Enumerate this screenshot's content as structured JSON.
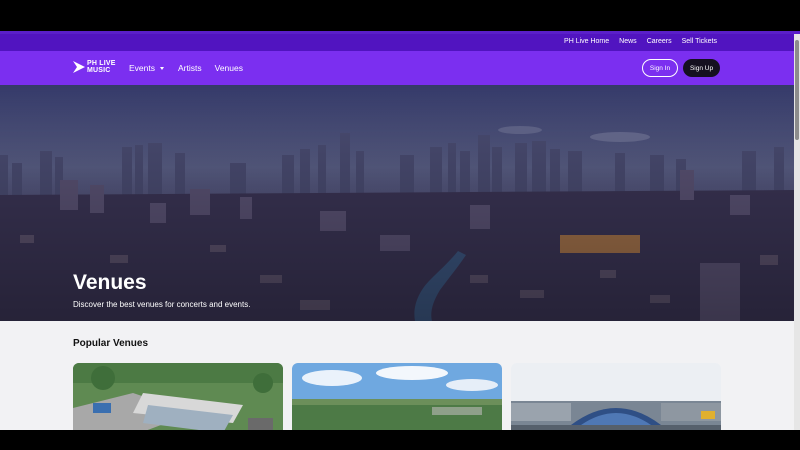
{
  "utility_bar": {
    "links": [
      "PH Live Home",
      "News",
      "Careers",
      "Sell Tickets"
    ]
  },
  "nav": {
    "logo_line1": "PH LIVE",
    "logo_line2": "MUSIC",
    "links": [
      "Events",
      "Artists",
      "Venues"
    ],
    "sign_in": "Sign In",
    "sign_up": "Sign Up"
  },
  "hero": {
    "title": "Venues",
    "subtitle": "Discover the best venues for concerts and events."
  },
  "popular": {
    "title": "Popular Venues"
  },
  "colors": {
    "utility_bar": "#5114c0",
    "nav": "#7b2ff0",
    "signup_bg": "#151020"
  }
}
